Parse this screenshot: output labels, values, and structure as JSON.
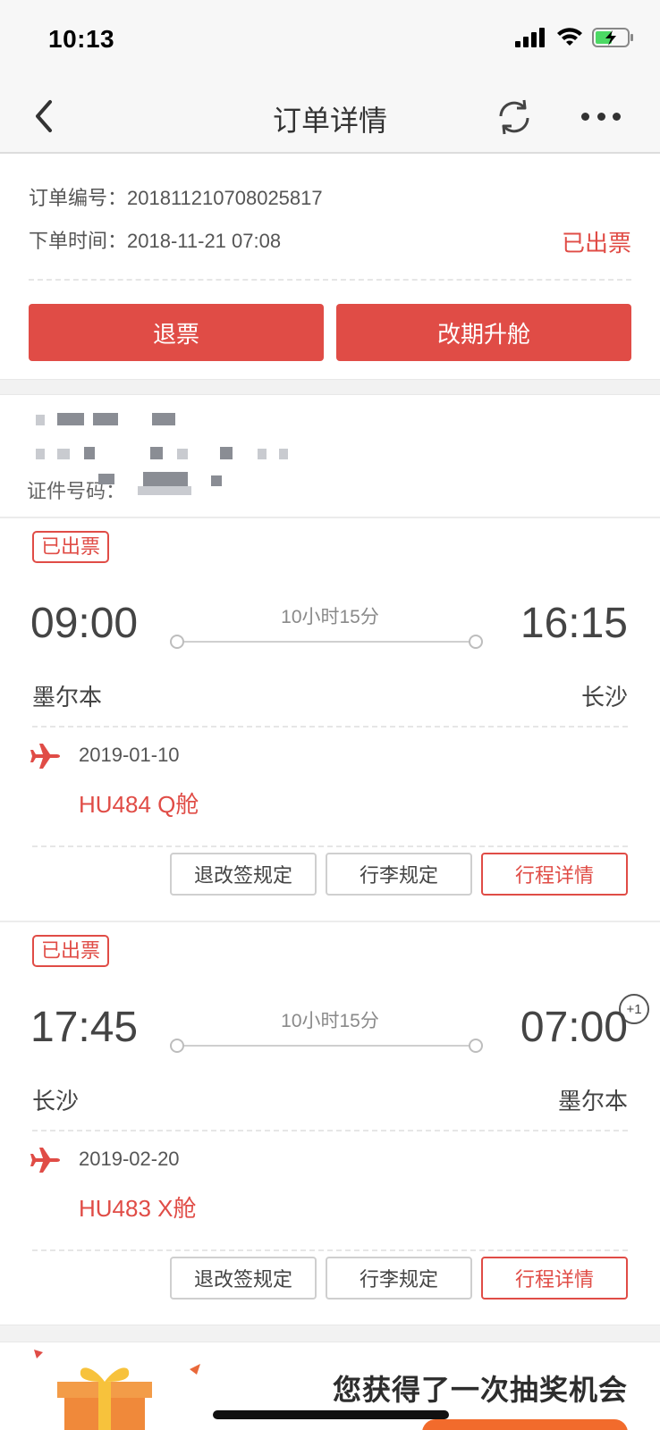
{
  "status_bar": {
    "time": "10:13"
  },
  "nav": {
    "title": "订单详情"
  },
  "order": {
    "number_label": "订单编号：",
    "number": "201811210708025817",
    "time_label": "下单时间：",
    "time": "2018-11-21 07:08",
    "status": "已出票",
    "refund_button": "退票",
    "change_button": "改期升舱"
  },
  "passenger": {
    "id_label": "证件号码："
  },
  "segments": [
    {
      "badge": "已出票",
      "dep_time": "09:00",
      "arr_time": "16:15",
      "duration": "10小时15分",
      "dep_city": "墨尔本",
      "arr_city": "长沙",
      "date": "2019-01-10",
      "flight": "HU484 Q舱",
      "plus_day": "",
      "btn_rules": "退改签规定",
      "btn_baggage": "行李规定",
      "btn_detail": "行程详情"
    },
    {
      "badge": "已出票",
      "dep_time": "17:45",
      "arr_time": "07:00",
      "duration": "10小时15分",
      "dep_city": "长沙",
      "arr_city": "墨尔本",
      "date": "2019-02-20",
      "flight": "HU483 X舱",
      "plus_day": "+1",
      "btn_rules": "退改签规定",
      "btn_baggage": "行李规定",
      "btn_detail": "行程详情"
    }
  ],
  "banner": {
    "text": "您获得了一次抽奖机会"
  },
  "colors": {
    "accent": "#e04c46",
    "banner_orange": "#f26b2c"
  }
}
